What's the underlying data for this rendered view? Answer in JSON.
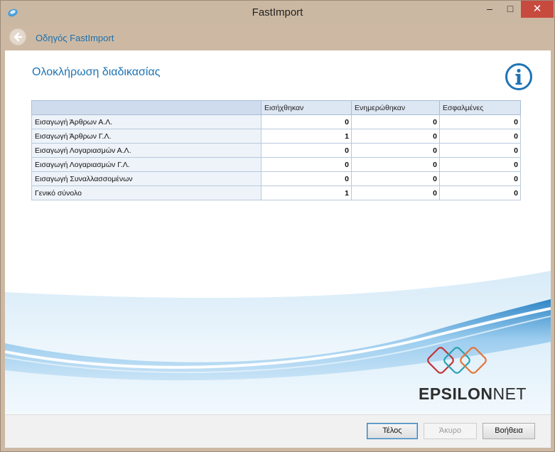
{
  "window": {
    "title": "FastImport",
    "minimize": "–",
    "maximize": "□",
    "close": "✕"
  },
  "nav": {
    "back_icon": "back-arrow-icon",
    "title": "Οδηγός FastImport"
  },
  "page": {
    "title": "Ολοκλήρωση διαδικασίας"
  },
  "table": {
    "columns": [
      "",
      "Εισήχθηκαν",
      "Ενημερώθηκαν",
      "Εσφαλμένες"
    ],
    "rows": [
      {
        "label": "Εισαγωγή Άρθρων Α.Λ.",
        "values": [
          "0",
          "0",
          "0"
        ]
      },
      {
        "label": "Εισαγωγή Άρθρων Γ.Λ.",
        "values": [
          "1",
          "0",
          "0"
        ]
      },
      {
        "label": "Εισαγωγή Λογαριασμών Α.Λ.",
        "values": [
          "0",
          "0",
          "0"
        ]
      },
      {
        "label": "Εισαγωγή Λογαριασμών Γ.Λ.",
        "values": [
          "0",
          "0",
          "0"
        ]
      },
      {
        "label": "Εισαγωγή Συναλλασσομένων",
        "values": [
          "0",
          "0",
          "0"
        ]
      },
      {
        "label": "Γενικό σύνολο",
        "values": [
          "1",
          "0",
          "0"
        ]
      }
    ]
  },
  "branding": {
    "logo_bold": "EPSILON",
    "logo_light": "NET"
  },
  "footer": {
    "finish": "Τέλος",
    "cancel": "Άκυρο",
    "help": "Βοήθεια"
  },
  "colors": {
    "accent": "#1d74b5",
    "close": "#c74a3f"
  }
}
